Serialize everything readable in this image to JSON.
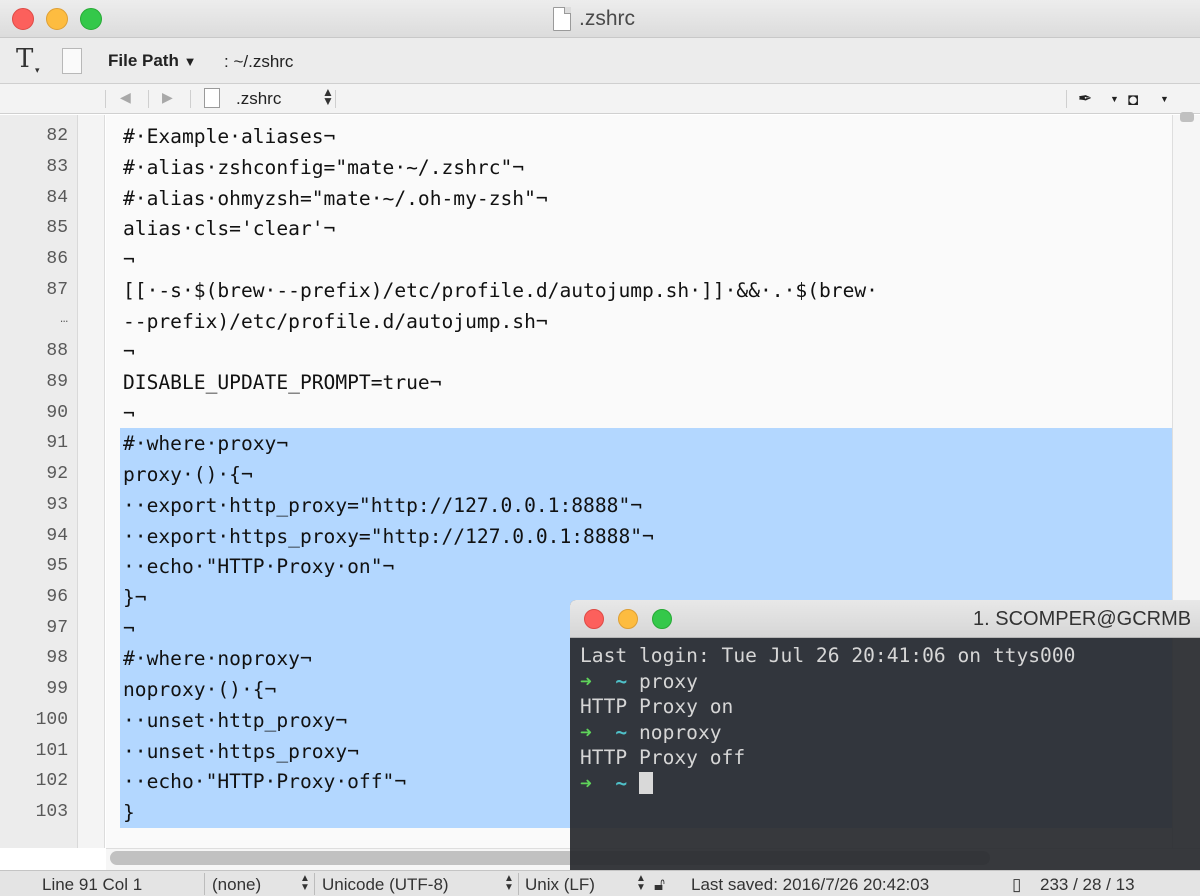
{
  "window": {
    "title": ".zshrc"
  },
  "toolbar": {
    "text_tool_icon": "T",
    "file_path_label": "File Path",
    "file_path_value": ": ~/.zshrc"
  },
  "nav": {
    "back_icon": "◀",
    "forward_icon": "▶",
    "file_name": ".zshrc"
  },
  "gutter": {
    "line_numbers": [
      "82",
      "83",
      "84",
      "85",
      "86",
      "87",
      "…",
      "88",
      "89",
      "90",
      "91",
      "92",
      "93",
      "94",
      "95",
      "96",
      "97",
      "98",
      "99",
      "100",
      "101",
      "102",
      "103"
    ]
  },
  "code": {
    "lines": [
      "#·Example·aliases¬",
      "#·alias·zshconfig=\"mate·~/.zshrc\"¬",
      "#·alias·ohmyzsh=\"mate·~/.oh-my-zsh\"¬",
      "alias·cls='clear'¬",
      "¬",
      "[[·-s·$(brew·--prefix)/etc/profile.d/autojump.sh·]]·&&·.·$(brew·",
      "--prefix)/etc/profile.d/autojump.sh¬",
      "¬",
      "DISABLE_UPDATE_PROMPT=true¬",
      "¬",
      "#·where·proxy¬",
      "proxy·()·{¬",
      "··export·http_proxy=\"http://127.0.0.1:8888\"¬",
      "··export·https_proxy=\"http://127.0.0.1:8888\"¬",
      "··echo·\"HTTP·Proxy·on\"¬",
      "}¬",
      "¬",
      "#·where·noproxy¬",
      "noproxy·()·{¬",
      "··unset·http_proxy¬",
      "··unset·https_proxy¬",
      "··echo·\"HTTP·Proxy·off\"¬",
      "}"
    ]
  },
  "status": {
    "position": "Line 91 Col 1",
    "grammar": "(none)",
    "encoding": "Unicode (UTF-8)",
    "line_endings": "Unix (LF)",
    "last_saved": "Last saved: 2016/7/26 20:42:03",
    "counts": "233 / 28 / 13"
  },
  "terminal": {
    "title": "1. SCOMPER@GCRMB",
    "last_login": "Last login: Tue Jul 26 20:41:06 on ttys000",
    "prompt_arrow": "➜",
    "prompt_dir": "~",
    "cmd1": "proxy",
    "out1": "HTTP Proxy on",
    "cmd2": "noproxy",
    "out2": "HTTP Proxy off"
  },
  "colors": {
    "selection": "#b3d7ff",
    "prompt_arrow": "#5fd35a",
    "prompt_dir": "#4fc1c9",
    "close": "#fc605c",
    "minimize": "#fdbc40",
    "zoom": "#34c84a"
  }
}
